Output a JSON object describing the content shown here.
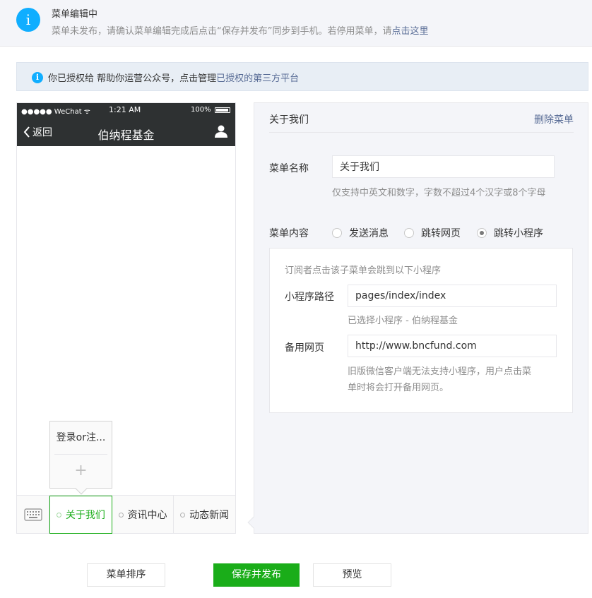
{
  "notice": {
    "title": "菜单编辑中",
    "desc_prefix": "菜单未发布，请确认菜单编辑完成后点击“保存并发布”同步到手机。若停用菜单，请",
    "desc_link": "点击这里"
  },
  "auth": {
    "text_prefix": "你已授权给   帮助你运营公众号，点击管理",
    "text_link": "已授权的第三方平台"
  },
  "phone": {
    "status_left": "●●●●● WeChat ᯤ",
    "status_time": "1:21 AM",
    "status_right": "100%",
    "back_label": "返回",
    "title": "伯纳程基金",
    "submenu": {
      "item": "登录or注...",
      "add": "+"
    },
    "menus": [
      "关于我们",
      "资讯中心",
      "动态新闻"
    ]
  },
  "editor": {
    "title": "关于我们",
    "delete_label": "删除菜单",
    "name_label": "菜单名称",
    "name_value": "关于我们",
    "name_hint": "仅支持中英文和数字，字数不超过4个汉字或8个字母",
    "content_label": "菜单内容",
    "content_options": [
      "发送消息",
      "跳转网页",
      "跳转小程序"
    ],
    "content_selected": "跳转小程序",
    "mp_intro": "订阅者点击该子菜单会跳到以下小程序",
    "mp_path_label": "小程序路径",
    "mp_path_value": "pages/index/index",
    "mp_selected": "已选择小程序 - 伯纳程基金",
    "fallback_label": "备用网页",
    "fallback_value": "http://www.bncfund.com",
    "fallback_hint_1": "旧版微信客户端无法支持小程序，用户点击菜",
    "fallback_hint_2": "单时将会打开备用网页。"
  },
  "buttons": {
    "sort": "菜单排序",
    "publish": "保存并发布",
    "preview": "预览"
  },
  "colors": {
    "accent_green": "#1aad19",
    "info_blue": "#10aeff",
    "link_blue": "#576b95"
  }
}
